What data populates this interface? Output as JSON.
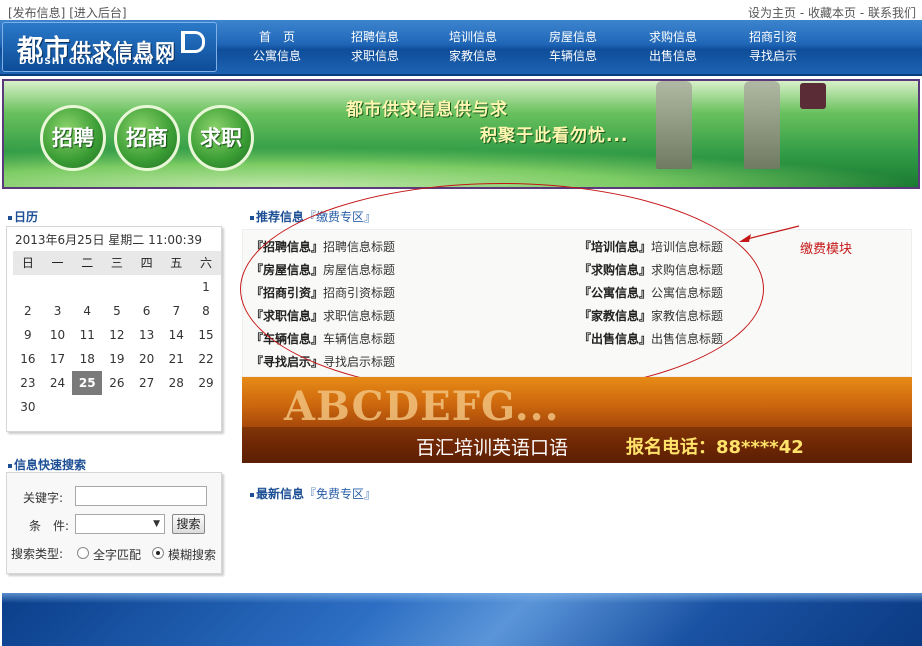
{
  "topbar": {
    "publish": "[发布信息]",
    "admin": "[进入后台]",
    "set_home": "设为主页",
    "favorite": "- 收藏本页",
    "contact": "- 联系我们"
  },
  "logo": {
    "cn_big": "都市",
    "cn_rest": "供求信息网",
    "en": "DOUSHI  GONG QIU XIN XI"
  },
  "nav": [
    {
      "top": "首　页",
      "bottom": "公寓信息"
    },
    {
      "top": "招聘信息",
      "bottom": "求职信息"
    },
    {
      "top": "培训信息",
      "bottom": "家教信息"
    },
    {
      "top": "房屋信息",
      "bottom": "车辆信息"
    },
    {
      "top": "求购信息",
      "bottom": "出售信息"
    },
    {
      "top": "招商引资",
      "bottom": "寻找启示"
    }
  ],
  "banner": {
    "circles": [
      "招聘",
      "招商",
      "求职"
    ],
    "line1": "都市供求信息供与求",
    "line2": "积聚于此看勿忧..."
  },
  "calendar": {
    "title": "日历",
    "now": "2013年6月25日  星期二   11:00:39",
    "weekdays": [
      "日",
      "一",
      "二",
      "三",
      "四",
      "五",
      "六"
    ],
    "weeks": [
      [
        "",
        "",
        "",
        "",
        "",
        "",
        "1"
      ],
      [
        "2",
        "3",
        "4",
        "5",
        "6",
        "7",
        "8"
      ],
      [
        "9",
        "10",
        "11",
        "12",
        "13",
        "14",
        "15"
      ],
      [
        "16",
        "17",
        "18",
        "19",
        "20",
        "21",
        "22"
      ],
      [
        "23",
        "24",
        "25",
        "26",
        "27",
        "28",
        "29"
      ],
      [
        "30",
        "",
        "",
        "",
        "",
        "",
        ""
      ]
    ],
    "selected": "25"
  },
  "quick_search": {
    "title": "信息快速搜索",
    "keyword_label": "关键字:",
    "keyword_value": "",
    "condition_label": "条　件:",
    "condition_value": "",
    "search_button": "搜索",
    "type_label": "搜索类型:",
    "option_exact": "全字匹配",
    "option_fuzzy": "模糊搜索"
  },
  "recommend": {
    "title": "推荐信息",
    "sub": "『缴费专区』",
    "items": [
      {
        "category": "『招聘信息』",
        "text": "招聘信息标题"
      },
      {
        "category": "『培训信息』",
        "text": "培训信息标题"
      },
      {
        "category": "『房屋信息』",
        "text": "房屋信息标题"
      },
      {
        "category": "『求购信息』",
        "text": "求购信息标题"
      },
      {
        "category": "『招商引资』",
        "text": "招商引资标题"
      },
      {
        "category": "『公寓信息』",
        "text": "公寓信息标题"
      },
      {
        "category": "『求职信息』",
        "text": "求职信息标题"
      },
      {
        "category": "『家教信息』",
        "text": "家教信息标题"
      },
      {
        "category": "『车辆信息』",
        "text": "车辆信息标题"
      },
      {
        "category": "『出售信息』",
        "text": "出售信息标题"
      },
      {
        "category": "『寻找启示』",
        "text": "寻找启示标题"
      }
    ]
  },
  "ad": {
    "letters": "ABCDEFG...",
    "text": "百汇培训英语口语",
    "phone": "报名电话：88****42"
  },
  "annotation": "缴费模块",
  "latest": {
    "title": "最新信息",
    "sub": "『免费专区』"
  },
  "colors": {
    "header_blue": "#1f66b7",
    "section_title": "#1d4f95",
    "annotation_red": "#c41818",
    "banner_green": "#2f9a45",
    "ad_orange": "#cf6a0e"
  }
}
